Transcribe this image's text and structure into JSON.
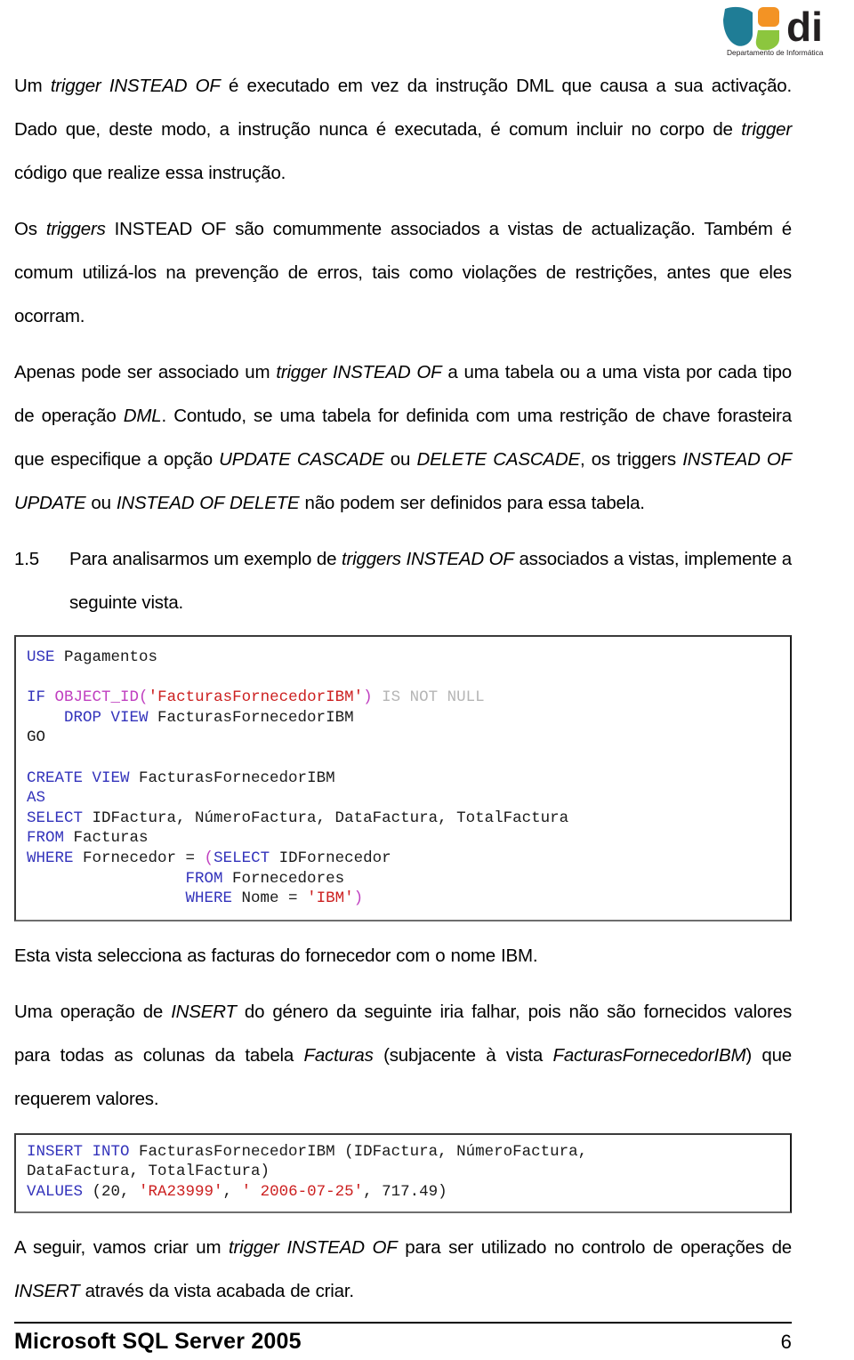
{
  "logo": {
    "wordmark": "di",
    "subtitle": "Departamento de Informática",
    "colors": {
      "teal": "#1f7d96",
      "orange": "#f39324",
      "green": "#8cc63e",
      "wordmark": "#231f20",
      "subtitle": "#231f20"
    }
  },
  "body": {
    "p1": {
      "s1": "Um ",
      "i1": "trigger INSTEAD OF",
      "s2": " é executado em vez da instrução DML que causa a sua activação. Dado que, deste modo, a instrução nunca é executada, é comum incluir no corpo de ",
      "i2": "trigger",
      "s3": " código que realize essa instrução."
    },
    "p2": {
      "s1": "Os ",
      "i1": "triggers",
      "s2": " INSTEAD OF são comummente associados a vistas de actualização. Também é comum utilizá-los na prevenção de erros, tais como violações de restrições, antes que eles ocorram."
    },
    "p3": {
      "s1": "Apenas pode ser associado um ",
      "i1": "trigger INSTEAD OF",
      "s2": " a uma tabela ou a uma vista por cada tipo de operação ",
      "i2": "DML",
      "s3": ". Contudo, se uma tabela for definida com uma restrição de chave forasteira que especifique a opção ",
      "i3": "UPDATE CASCADE",
      "s4": " ou ",
      "i4": "DELETE CASCADE",
      "s5": ", os triggers ",
      "i5": "INSTEAD OF UPDATE",
      "s6": " ou ",
      "i6": "INSTEAD OF DELETE",
      "s7": " não podem ser definidos para essa tabela."
    },
    "item15": {
      "number": "1.5",
      "s1": "Para analisarmos um exemplo de ",
      "i1": "triggers INSTEAD OF",
      "s2": " associados a vistas, implemente a seguinte vista."
    },
    "p4": {
      "s1": "Esta vista selecciona as facturas do fornecedor com o nome IBM."
    },
    "p5": {
      "s1": "Uma operação de ",
      "i1": "INSERT",
      "s2": " do género da seguinte iria falhar, pois não são fornecidos valores para todas as colunas da tabela ",
      "i2": "Facturas",
      "s3": " (subjacente à vista ",
      "i3": "FacturasFornecedorIBM",
      "s4": ") que requerem valores."
    },
    "p6": {
      "s1": "A seguir, vamos criar um ",
      "i1": "trigger INSTEAD OF",
      "s2": " para ser utilizado no controlo de operações de ",
      "i2": "INSERT",
      "s3": " através da vista acabada de criar."
    }
  },
  "code_block_1": {
    "lines": [
      [
        {
          "t": "USE",
          "c": "kw"
        },
        {
          "t": " Pagamentos",
          "c": "pln"
        }
      ],
      [],
      [
        {
          "t": "IF",
          "c": "kw"
        },
        {
          "t": " ",
          "c": "pln"
        },
        {
          "t": "OBJECT_ID",
          "c": "fn"
        },
        {
          "t": "(",
          "c": "fn"
        },
        {
          "t": "'FacturasFornecedorIBM'",
          "c": "str"
        },
        {
          "t": ")",
          "c": "fn"
        },
        {
          "t": " ",
          "c": "pln"
        },
        {
          "t": "IS NOT NULL",
          "c": "gry"
        }
      ],
      [
        {
          "t": "    ",
          "c": "pln"
        },
        {
          "t": "DROP VIEW",
          "c": "kw"
        },
        {
          "t": " FacturasFornecedorIBM",
          "c": "pln"
        }
      ],
      [
        {
          "t": "GO",
          "c": "pln"
        }
      ],
      [],
      [
        {
          "t": "CREATE VIEW",
          "c": "kw"
        },
        {
          "t": " FacturasFornecedorIBM",
          "c": "pln"
        }
      ],
      [
        {
          "t": "AS",
          "c": "kw"
        }
      ],
      [
        {
          "t": "SELECT",
          "c": "kw"
        },
        {
          "t": " IDFactura, NúmeroFactura, DataFactura, TotalFactura",
          "c": "pln"
        }
      ],
      [
        {
          "t": "FROM",
          "c": "kw"
        },
        {
          "t": " Facturas",
          "c": "pln"
        }
      ],
      [
        {
          "t": "WHERE",
          "c": "kw"
        },
        {
          "t": " Fornecedor = ",
          "c": "pln"
        },
        {
          "t": "(",
          "c": "fn"
        },
        {
          "t": "SELECT",
          "c": "kw"
        },
        {
          "t": " IDFornecedor",
          "c": "pln"
        }
      ],
      [
        {
          "t": "                 ",
          "c": "pln"
        },
        {
          "t": "FROM",
          "c": "kw"
        },
        {
          "t": " Fornecedores",
          "c": "pln"
        }
      ],
      [
        {
          "t": "                 ",
          "c": "pln"
        },
        {
          "t": "WHERE",
          "c": "kw"
        },
        {
          "t": " Nome = ",
          "c": "pln"
        },
        {
          "t": "'IBM'",
          "c": "str"
        },
        {
          "t": ")",
          "c": "fn"
        }
      ]
    ]
  },
  "code_block_2": {
    "lines": [
      [
        {
          "t": "INSERT INTO",
          "c": "kw"
        },
        {
          "t": " FacturasFornecedorIBM (IDFactura, NúmeroFactura,",
          "c": "pln"
        }
      ],
      [
        {
          "t": "DataFactura, TotalFactura)",
          "c": "pln"
        }
      ],
      [
        {
          "t": "VALUES",
          "c": "kw"
        },
        {
          "t": " (20, ",
          "c": "pln"
        },
        {
          "t": "'RA23999'",
          "c": "str"
        },
        {
          "t": ", ",
          "c": "pln"
        },
        {
          "t": "' 2006-07-25'",
          "c": "str"
        },
        {
          "t": ", 717.49)",
          "c": "pln"
        }
      ]
    ]
  },
  "footer": {
    "title": "Microsoft SQL Server 2005",
    "page": "6"
  }
}
